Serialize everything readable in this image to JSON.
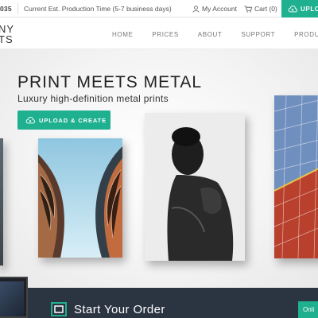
{
  "topbar": {
    "phone_fragment": "035",
    "production_time": "Current Est. Production Time (5-7 business days)",
    "account_label": "My Account",
    "cart_label": "Cart (0)",
    "upload_label": "UPLO"
  },
  "logo": {
    "line1": "NY",
    "line2": "TS"
  },
  "nav": {
    "items": [
      "HOME",
      "PRICES",
      "ABOUT",
      "SUPPORT",
      "PRODUCTS"
    ]
  },
  "hero": {
    "title": "PRINT MEETS METAL",
    "subtitle": "Luxury high-definition metal prints",
    "button_label": "UPLOAD & CREATE"
  },
  "bottom": {
    "heading": "Start Your Order",
    "online_label": "Onli"
  },
  "colors": {
    "accent": "#1fb08f",
    "dark_bar": "#2b3441"
  },
  "icons": [
    "user-icon",
    "cart-icon",
    "cloud-upload-icon",
    "order-frame-icon"
  ]
}
